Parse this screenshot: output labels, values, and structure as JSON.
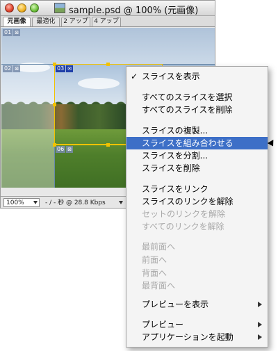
{
  "window": {
    "title": "sample.psd @ 100% (元画像)",
    "tabs": [
      "元画像",
      "最適化",
      "2 アップ",
      "4 アップ"
    ],
    "active_tab_index": 0
  },
  "slices": {
    "s01": "01",
    "s02": "02",
    "s03": "03",
    "s06": "06"
  },
  "statusbar": {
    "zoom": "100%",
    "info": "- / - 秒 @ 28.8 Kbps"
  },
  "menu": {
    "check_mark": "✓",
    "items": [
      {
        "label": "スライスを表示",
        "checked": true,
        "disabled": false
      },
      {
        "label": "すべてのスライスを選択",
        "disabled": false
      },
      {
        "label": "すべてのスライスを削除",
        "disabled": false
      },
      {
        "label": "スライスの複製...",
        "disabled": false
      },
      {
        "label": "スライスを組み合わせる",
        "disabled": false,
        "highlighted": true
      },
      {
        "label": "スライスを分割...",
        "disabled": false
      },
      {
        "label": "スライスを削除",
        "disabled": false
      },
      {
        "label": "スライスをリンク",
        "disabled": false
      },
      {
        "label": "スライスのリンクを解除",
        "disabled": false
      },
      {
        "label": "セットのリンクを解除",
        "disabled": true
      },
      {
        "label": "すべてのリンクを解除",
        "disabled": true
      },
      {
        "label": "最前面へ",
        "disabled": true
      },
      {
        "label": "前面へ",
        "disabled": true
      },
      {
        "label": "背面へ",
        "disabled": true
      },
      {
        "label": "最背面へ",
        "disabled": true
      },
      {
        "label": "プレビューを表示",
        "disabled": false,
        "submenu": true
      },
      {
        "label": "プレビュー",
        "disabled": false,
        "submenu": true
      },
      {
        "label": "アプリケーションを起動",
        "disabled": false,
        "submenu": true
      }
    ]
  },
  "colors": {
    "highlight": "#3d6fc7",
    "selection": "#f2c200",
    "active_slice_tag": "#1f3fa8"
  }
}
